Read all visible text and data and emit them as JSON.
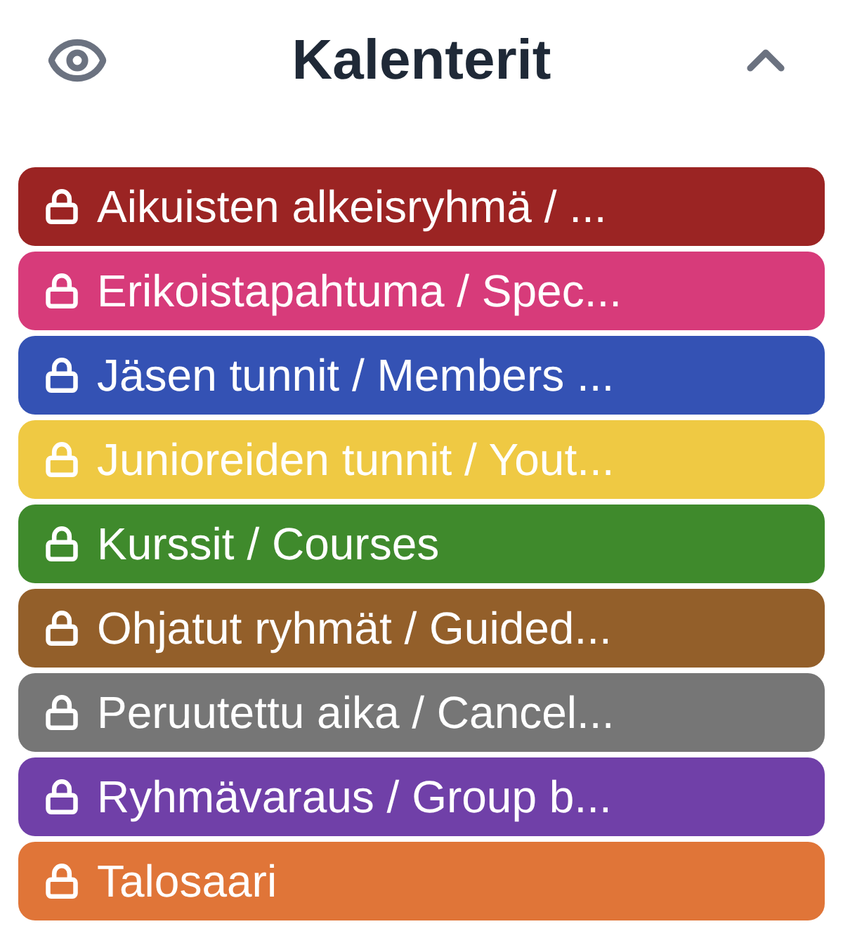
{
  "header": {
    "title": "Kalenterit",
    "visible": true,
    "expanded": true
  },
  "calendars": [
    {
      "name": "Aikuisten alkeisryhmä / ...",
      "color": "#9b2423",
      "locked": true
    },
    {
      "name": "Erikoistapahtuma / Spec...",
      "color": "#d73b7a",
      "locked": true
    },
    {
      "name": "Jäsen tunnit / Members ...",
      "color": "#3452b4",
      "locked": true
    },
    {
      "name": "Junioreiden tunnit / Yout...",
      "color": "#efc943",
      "locked": true
    },
    {
      "name": "Kurssit / Courses",
      "color": "#3f8a2c",
      "locked": true
    },
    {
      "name": "Ohjatut ryhmät / Guided...",
      "color": "#935f2a",
      "locked": true
    },
    {
      "name": "Peruutettu aika / Cancel...",
      "color": "#767676",
      "locked": true
    },
    {
      "name": "Ryhmävaraus / Group b...",
      "color": "#7040a8",
      "locked": true
    },
    {
      "name": "Talosaari",
      "color": "#e07538",
      "locked": true
    }
  ]
}
